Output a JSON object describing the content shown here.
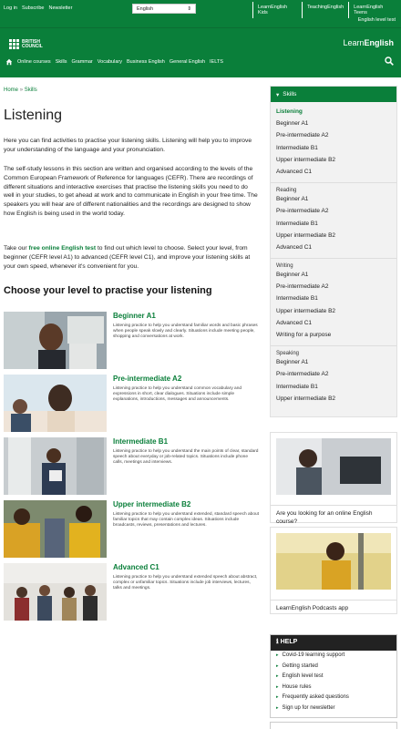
{
  "top": {
    "links": [
      "Log in",
      "Subscribe",
      "Newsletter"
    ],
    "language": "English",
    "sites": [
      "LearnEnglish Kids",
      "TeachingEnglish",
      "LearnEnglish Teens"
    ],
    "level_test": "English level test"
  },
  "header": {
    "logo_line1": "BRITISH",
    "logo_line2": "COUNCIL",
    "brand1": "Learn",
    "brand2": "English",
    "nav": [
      "Online courses",
      "Skills",
      "Grammar",
      "Vocabulary",
      "Business English",
      "General English",
      "IELTS"
    ]
  },
  "breadcrumb": {
    "home": "Home",
    "sep": "»",
    "current": "Skills"
  },
  "page": {
    "title": "Listening",
    "intro": "Here you can find activities to practise your listening skills. Listening will help you to improve your understanding of the language and your pronunciation.",
    "para2": "The self-study lessons in this section are written and organised according to the levels of the Common European Framework of Reference for languages (CEFR). There are recordings of different situations and interactive exercises that practise the listening skills you need to do well in your studies, to get ahead at work and to communicate in English in your free time. The speakers you will hear are of different nationalities and the recordings are designed to show how English is being used in the world today.",
    "para3_a": "Take our ",
    "para3_link": "free online English test",
    "para3_b": " to find out which level to choose. Select your level, from beginner (CEFR level A1) to advanced (CEFR level C1), and improve your listening skills at your own speed, whenever it's convenient for you.",
    "choose": "Choose your level to practise your listening"
  },
  "levels": [
    {
      "title": "Beginner A1",
      "desc": "Listening practice to help you understand familiar words and basic phrases when people speak slowly and clearly. Situations include meeting people, shopping and conversations at work."
    },
    {
      "title": "Pre-intermediate A2",
      "desc": "Listening practice to help you understand common vocabulary and expressions in short, clear dialogues. Situations include simple explanations, introductions, messages and announcements."
    },
    {
      "title": "Intermediate B1",
      "desc": "Listening practice to help you understand the main points of clear, standard speech about everyday or job-related topics. Situations include phone calls, meetings and interviews."
    },
    {
      "title": "Upper intermediate B2",
      "desc": "Listening practice to help you understand extended, standard speech about familiar topics that may contain complex ideas. Situations include broadcasts, reviews, presentations and lectures."
    },
    {
      "title": "Advanced C1",
      "desc": "Listening practice to help you understand extended speech about abstract, complex or unfamiliar topics. Situations include job interviews, lectures, talks and meetings."
    }
  ],
  "sidebar": {
    "head": "Skills",
    "groups": [
      {
        "cat": "",
        "items": [
          "Listening",
          "Beginner A1",
          "Pre-intermediate A2",
          "Intermediate B1",
          "Upper intermediate B2",
          "Advanced C1"
        ]
      },
      {
        "cat": "Reading",
        "items": [
          "Beginner A1",
          "Pre-intermediate A2",
          "Intermediate B1",
          "Upper intermediate B2",
          "Advanced C1"
        ]
      },
      {
        "cat": "Writing",
        "items": [
          "Beginner A1",
          "Pre-intermediate A2",
          "Intermediate B1",
          "Upper intermediate B2",
          "Advanced C1",
          "Writing for a purpose"
        ]
      },
      {
        "cat": "Speaking",
        "items": [
          "Beginner A1",
          "Pre-intermediate A2",
          "Intermediate B1",
          "Upper intermediate B2"
        ]
      }
    ]
  },
  "promo1": "Are you looking for an online English course?",
  "promo2": "LearnEnglish Podcasts app",
  "help": {
    "title": "HELP",
    "items": [
      "Covid-19 learning support",
      "Getting started",
      "English level test",
      "House rules",
      "Frequently asked questions",
      "Sign up for newsletter"
    ]
  }
}
